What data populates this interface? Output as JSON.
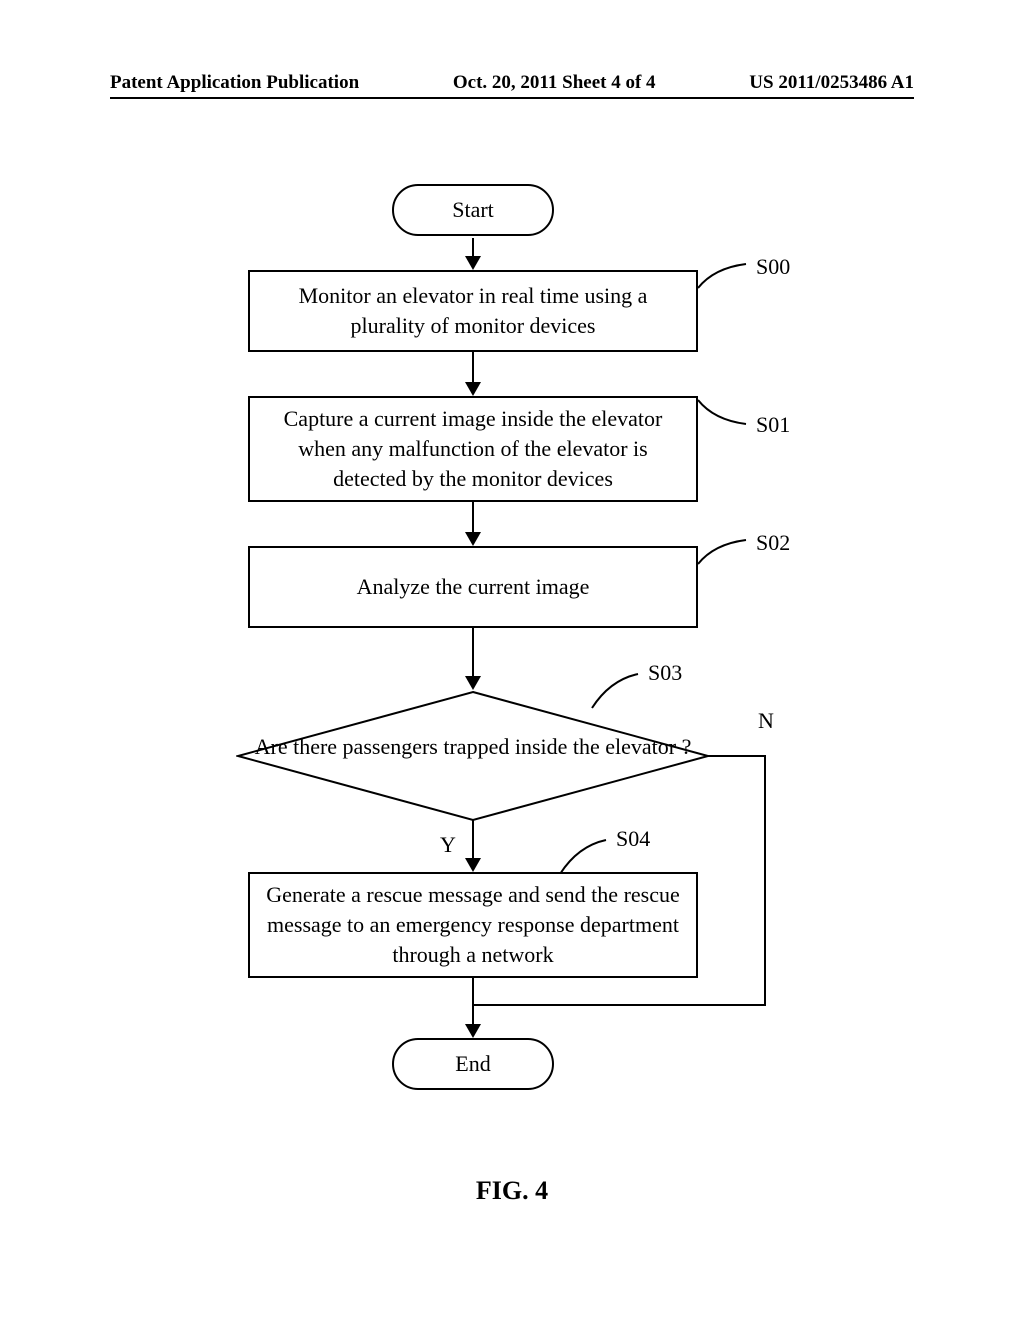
{
  "header": {
    "left": "Patent Application Publication",
    "center": "Oct. 20, 2011  Sheet 4 of 4",
    "right": "US 2011/0253486 A1"
  },
  "flow": {
    "start": "Start",
    "s00": {
      "label": "S00",
      "text": "Monitor an elevator in real time using a plurality of monitor devices"
    },
    "s01": {
      "label": "S01",
      "text": "Capture a current image inside the elevator when any malfunction of the elevator is detected by the monitor devices"
    },
    "s02": {
      "label": "S02",
      "text": "Analyze the current image"
    },
    "s03": {
      "label": "S03",
      "text": "Are there passengers trapped inside the elevator ?",
      "yes": "Y",
      "no": "N"
    },
    "s04": {
      "label": "S04",
      "text": "Generate a rescue message and send the rescue message to an emergency response department through a network"
    },
    "end": "End"
  },
  "figure": "FIG. 4"
}
